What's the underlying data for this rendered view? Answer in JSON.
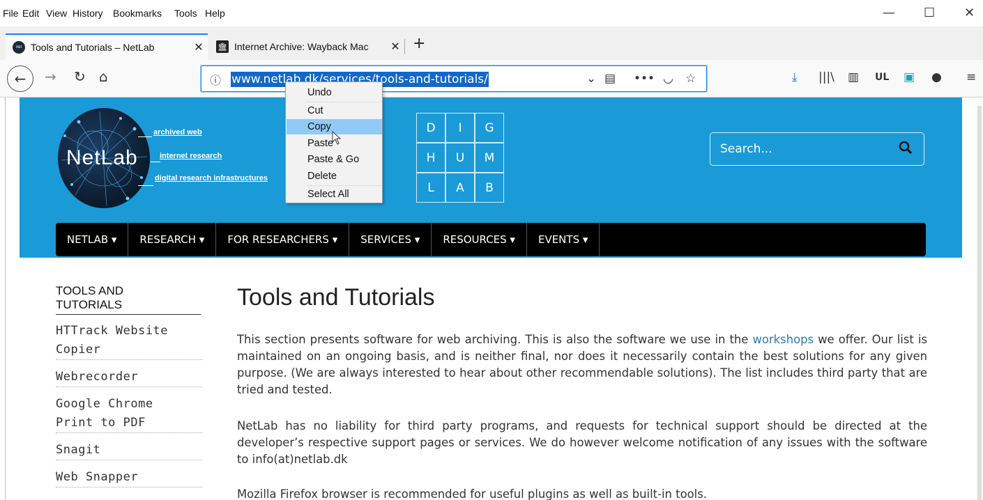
{
  "menubar": {
    "items": [
      "File",
      "Edit",
      "View",
      "History",
      "Bookmarks",
      "Tools",
      "Help"
    ],
    "window_controls": {
      "minimize": "—",
      "maximize": "☐",
      "close": "✕"
    }
  },
  "tabs": [
    {
      "title": "Tools and Tutorials – NetLab",
      "active": true,
      "icon": "netlab-favicon",
      "close": "✕"
    },
    {
      "title": "Internet Archive: Wayback Mac",
      "active": false,
      "icon": "internet-archive-icon",
      "close": "✕"
    }
  ],
  "newtab": "+",
  "navbar": {
    "url": "www.netlab.dk/services/tools-and-tutorials/",
    "toolbar_ul": "UL"
  },
  "context_menu": {
    "items": [
      "Undo",
      "Cut",
      "Copy",
      "Paste",
      "Paste & Go",
      "Delete",
      "Select All"
    ],
    "highlighted": "Copy"
  },
  "header": {
    "logo_text": "NetLab",
    "taglines": [
      "archived web",
      "internet research",
      "digital research infrastructures"
    ],
    "dighumlab": [
      "D",
      "I",
      "G",
      "H",
      "U",
      "M",
      "L",
      "A",
      "B"
    ],
    "search_placeholder": "Search..."
  },
  "nav": [
    "NETLAB ▾",
    "RESEARCH ▾",
    "FOR RESEARCHERS ▾",
    "SERVICES ▾",
    "RESOURCES ▾",
    "EVENTS ▾"
  ],
  "sidebar": {
    "title_line1": "TOOLS AND",
    "title_line2": "TUTORIALS",
    "items": [
      "HTTrack Website",
      "Copier",
      "Webrecorder",
      "Google Chrome",
      "Print to PDF",
      "Snagit",
      "Web Snapper"
    ]
  },
  "main": {
    "title": "Tools and Tutorials",
    "p1_before": "This section presents software for web archiving. This is also the software we use in the ",
    "p1_link": "workshops",
    "p1_after": " we offer. Our list is maintained on an ongoing basis, and is neither final, nor does it necessarily contain the best solutions for any given purpose. (We are always interested to hear about other recommendable solutions). The list includes third party that are tried and tested.",
    "p2": "NetLab has no liability for third party programs, and requests for technical support should be directed at the developer’s respective support pages or services. We do however welcome notification of any issues with the software to info(at)netlab.dk",
    "p3": "Mozilla Firefox browser is recommended for useful plugins as well as built-in tools."
  }
}
